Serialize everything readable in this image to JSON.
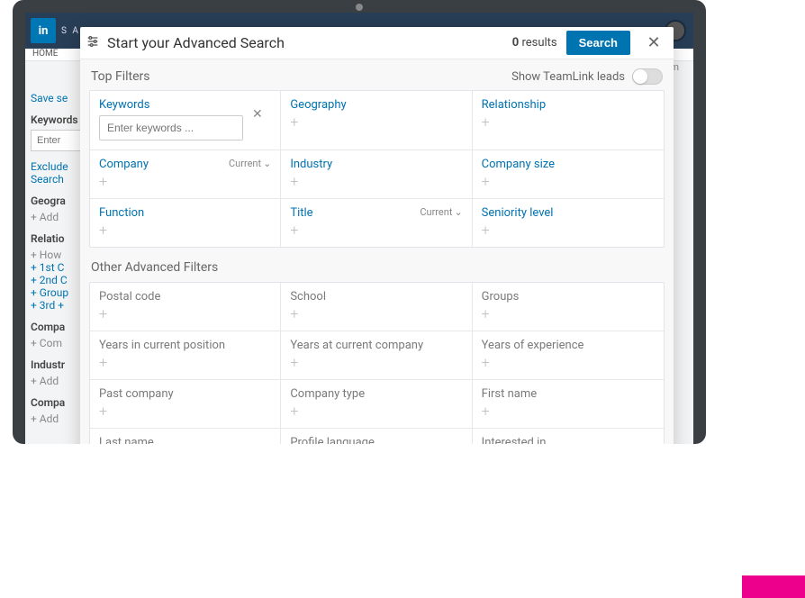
{
  "device": {
    "topbar_brand_text": "S A"
  },
  "background": {
    "home_tab": "HOME",
    "save_search": "Save se",
    "keywords_label": "Keywords",
    "keywords_placeholder": "Enter",
    "exclude": "Exclude",
    "search": "Search",
    "geography_label": "Geogra",
    "add": "Add",
    "relationship_label": "Relatio",
    "how": "How",
    "first": "1st C",
    "second": "2nd C",
    "group": "Group",
    "third": "3rd +",
    "company_label": "Compa",
    "com": "Com",
    "industry_label": "Industr",
    "url_remnant": "nkedin.com"
  },
  "modal": {
    "title": "Start your Advanced Search",
    "results_count": "0",
    "results_label": "results",
    "search_button": "Search",
    "teamlink_label": "Show TeamLink leads",
    "top_filters_label": "Top Filters",
    "other_filters_label": "Other Advanced Filters",
    "keywords_placeholder": "Enter keywords ...",
    "current_label": "Current",
    "top": [
      {
        "label": "Keywords"
      },
      {
        "label": "Geography"
      },
      {
        "label": "Relationship"
      },
      {
        "label": "Company",
        "current": true
      },
      {
        "label": "Industry"
      },
      {
        "label": "Company size"
      },
      {
        "label": "Function"
      },
      {
        "label": "Title",
        "current": true
      },
      {
        "label": "Seniority level"
      }
    ],
    "other": [
      {
        "label": "Postal code"
      },
      {
        "label": "School"
      },
      {
        "label": "Groups"
      },
      {
        "label": "Years in current position"
      },
      {
        "label": "Years at current company"
      },
      {
        "label": "Years of experience"
      },
      {
        "label": "Past company"
      },
      {
        "label": "Company type"
      },
      {
        "label": "First name"
      },
      {
        "label": "Last name"
      },
      {
        "label": "Profile language"
      },
      {
        "label": "Interested in"
      }
    ]
  }
}
